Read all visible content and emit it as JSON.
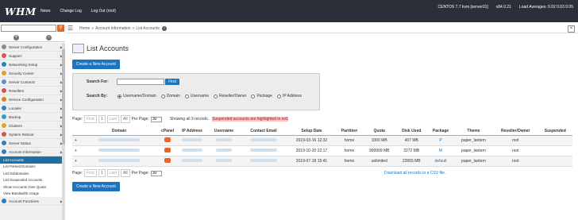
{
  "top": {
    "logo": "WHM",
    "nav": [
      "News",
      "Change Log",
      "Log Out (root)"
    ],
    "server": "CENTOS 7.7 kvm [server01]",
    "version": "v84.0.21",
    "load": "Load Averages: 0.02 0.03 0.05"
  },
  "search": {
    "placeholder": "",
    "icon": "search-icon"
  },
  "breadcrumb": {
    "home": "Home",
    "sep": "»",
    "section": "Account Information",
    "page": "List Accounts",
    "help": "?"
  },
  "sidebar": {
    "items": [
      {
        "label": "Server Configuration",
        "color": "#8a8a8a"
      },
      {
        "label": "Support",
        "color": "#d9534f"
      },
      {
        "label": "Networking Setup",
        "color": "#2b7fc3"
      },
      {
        "label": "Security Center",
        "color": "#e0a12b"
      },
      {
        "label": "Server Contacts",
        "color": "#5b8fd1"
      },
      {
        "label": "Resellers",
        "color": "#d9534f"
      },
      {
        "label": "Service Configuration",
        "color": "#e07b2b"
      },
      {
        "label": "Locales",
        "color": "#2b7fc3"
      },
      {
        "label": "Backup",
        "color": "#2b9fc3"
      },
      {
        "label": "Clusters",
        "color": "#e0a12b"
      },
      {
        "label": "System Reboot",
        "color": "#d9534f"
      },
      {
        "label": "Server Status",
        "color": "#2b7fc3"
      },
      {
        "label": "Account Information",
        "color": "#2b7fc3"
      }
    ],
    "subitems": [
      {
        "label": "List Accounts",
        "active": true
      },
      {
        "label": "List Parked Domains"
      },
      {
        "label": "List Subdomains"
      },
      {
        "label": "List Suspended Accounts"
      },
      {
        "label": "Show Accounts Over Quota"
      },
      {
        "label": "View Bandwidth Usage"
      }
    ],
    "last": {
      "label": "Account Functions",
      "color": "#2b7fc3"
    }
  },
  "main": {
    "title": "List Accounts",
    "create_button": "Create a New Account",
    "search_for_label": "Search For:",
    "find_button": "Find",
    "search_by_label": "Search By:",
    "search_by_options": [
      "Username/Domain",
      "Domain",
      "Username",
      "Reseller/Owner",
      "Package",
      "IP Address"
    ],
    "pager_label": "Page:",
    "pager_buttons": [
      "First",
      "1",
      "Last",
      "All"
    ],
    "per_page_label": "Per Page:",
    "per_page_value": "30",
    "records_text": "Showing all 3 records.",
    "suspended_note": "Suspended accounts are highlighted in red.",
    "download_link": "Download all records to a CSV file."
  },
  "table": {
    "columns": [
      "",
      "Domain",
      "cPanel",
      "IP Address",
      "Username",
      "Contact Email",
      "Setup Date",
      "Partition",
      "Quota",
      "Disk Used",
      "Package",
      "Theme",
      "Reseller/Owner",
      "Suspended"
    ],
    "rows": [
      {
        "expand": "+",
        "setup": "2019-03-16 12:32",
        "partition": "home",
        "quota": "1000 MB",
        "disk": "407 MB",
        "package": "P",
        "theme": "paper_lantern",
        "owner": "root",
        "suspended": ""
      },
      {
        "expand": "+",
        "setup": "2019-10-20 22:17",
        "partition": "home",
        "quota": "999999 MB",
        "disk": "3272 MB",
        "package": "M",
        "theme": "paper_lantern",
        "owner": "root",
        "suspended": ""
      },
      {
        "expand": "+",
        "setup": "2019-07-18 15:41",
        "partition": "home",
        "quota": "unlimited",
        "disk": "22655 MB",
        "package": "default",
        "theme": "paper_lantern",
        "owner": "root",
        "suspended": ""
      }
    ]
  }
}
